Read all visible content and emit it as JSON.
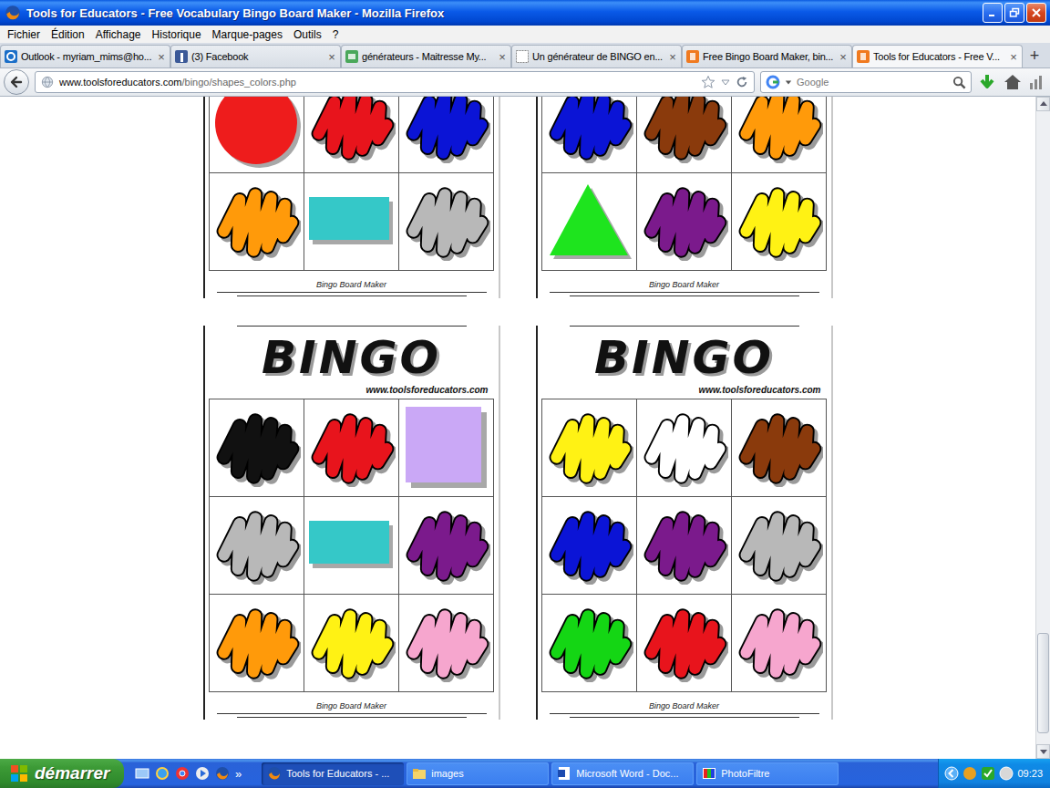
{
  "window": {
    "title": "Tools for Educators - Free Vocabulary Bingo Board Maker - Mozilla Firefox"
  },
  "menu": [
    "Fichier",
    "Édition",
    "Affichage",
    "Historique",
    "Marque-pages",
    "Outils",
    "?"
  ],
  "tabs": [
    {
      "label": "Outlook - myriam_mims@ho...",
      "selected": false,
      "kind": "outlook"
    },
    {
      "label": "(3) Facebook",
      "selected": false,
      "kind": "facebook"
    },
    {
      "label": "générateurs - Maitresse My...",
      "selected": false,
      "kind": "eb"
    },
    {
      "label": "Un générateur de BINGO en...",
      "selected": false,
      "kind": "blank"
    },
    {
      "label": "Free Bingo Board Maker, bin...",
      "selected": false,
      "kind": "tfe"
    },
    {
      "label": "Tools for Educators - Free V...",
      "selected": true,
      "kind": "tfe"
    }
  ],
  "tab_close": "×",
  "new_tab": "+",
  "address_bar": {
    "host": "www.toolsforeducators.com",
    "path": "/bingo/shapes_colors.php"
  },
  "search": {
    "placeholder": "Google"
  },
  "boards": [
    {
      "footer": "Bingo Board Maker",
      "rows": [
        [
          {
            "kind": "circle",
            "color": "#ee1c1c"
          },
          {
            "kind": "scribble",
            "color": "#e8141c"
          },
          {
            "kind": "scribble",
            "color": "#0b14d6"
          }
        ],
        [
          {
            "kind": "scribble",
            "color": "#ff9a0a"
          },
          {
            "kind": "rectangle",
            "color": "#35c8c8"
          },
          {
            "kind": "scribble",
            "color": "#b8b8b8"
          }
        ]
      ]
    },
    {
      "footer": "Bingo Board Maker",
      "rows": [
        [
          {
            "kind": "scribble",
            "color": "#0b14d6"
          },
          {
            "kind": "scribble",
            "color": "#8a3a0c"
          },
          {
            "kind": "scribble",
            "color": "#ff9a0a"
          }
        ],
        [
          {
            "kind": "triangle",
            "color": "#1ee41e"
          },
          {
            "kind": "scribble",
            "color": "#7b1a8c"
          },
          {
            "kind": "scribble",
            "color": "#fff214"
          }
        ]
      ]
    },
    {
      "title": "BINGO",
      "site": "www.toolsforeducators.com",
      "footer": "Bingo Board Maker",
      "rows": [
        [
          {
            "kind": "scribble",
            "color": "#111111"
          },
          {
            "kind": "scribble",
            "color": "#e8141c"
          },
          {
            "kind": "square",
            "color": "#caa8f6"
          }
        ],
        [
          {
            "kind": "scribble",
            "color": "#b8b8b8"
          },
          {
            "kind": "rectangle",
            "color": "#35c8c8"
          },
          {
            "kind": "scribble",
            "color": "#7b1a8c"
          }
        ],
        [
          {
            "kind": "scribble",
            "color": "#ff9a0a"
          },
          {
            "kind": "scribble",
            "color": "#fff214"
          },
          {
            "kind": "scribble",
            "color": "#f6a6ce"
          }
        ]
      ]
    },
    {
      "title": "BINGO",
      "site": "www.toolsforeducators.com",
      "footer": "Bingo Board Maker",
      "rows": [
        [
          {
            "kind": "scribble",
            "color": "#fff214"
          },
          {
            "kind": "scribble",
            "color": "#ffffff"
          },
          {
            "kind": "scribble",
            "color": "#8a3a0c"
          }
        ],
        [
          {
            "kind": "scribble",
            "color": "#0b14d6"
          },
          {
            "kind": "scribble",
            "color": "#7b1a8c"
          },
          {
            "kind": "scribble",
            "color": "#b8b8b8"
          }
        ],
        [
          {
            "kind": "scribble",
            "color": "#14d614"
          },
          {
            "kind": "scribble",
            "color": "#e8141c"
          },
          {
            "kind": "scribble",
            "color": "#f6a6ce"
          }
        ]
      ]
    }
  ],
  "scrollbar": {
    "level": 0.98
  },
  "taskbar": {
    "start": "démarrer",
    "more": "»",
    "tasks": [
      {
        "label": "Tools for Educators - ...",
        "selected": true,
        "kind": "firefox"
      },
      {
        "label": "images",
        "selected": false,
        "kind": "folder"
      },
      {
        "label": "Microsoft Word - Doc...",
        "selected": false,
        "kind": "word"
      },
      {
        "label": "PhotoFiltre",
        "selected": false,
        "kind": "photofiltre"
      }
    ],
    "clock": "09:23"
  }
}
